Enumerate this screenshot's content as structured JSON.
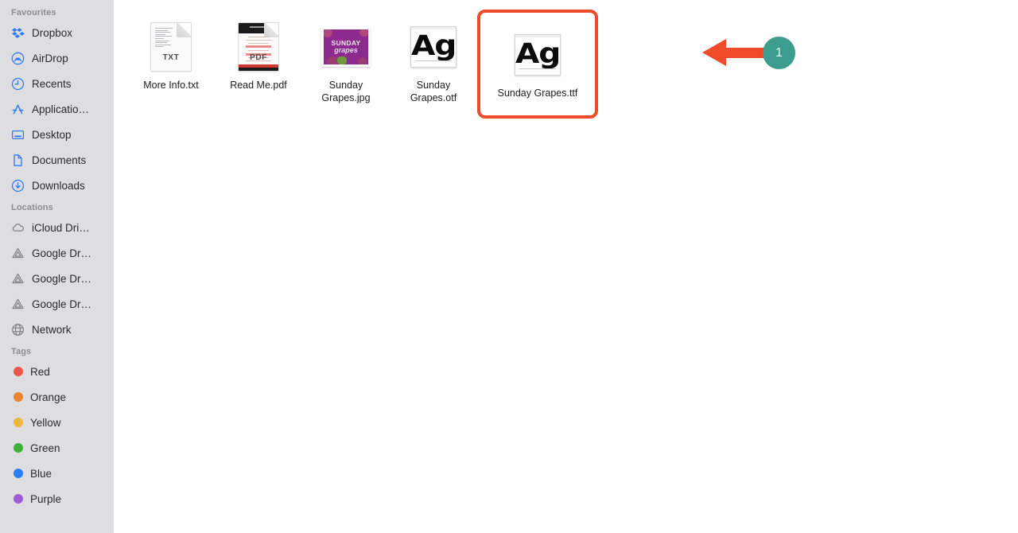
{
  "sidebar": {
    "sections": [
      {
        "title": "Favourites",
        "items": [
          {
            "label": "Dropbox",
            "icon": "dropbox-icon"
          },
          {
            "label": "AirDrop",
            "icon": "airdrop-icon"
          },
          {
            "label": "Recents",
            "icon": "clock-icon"
          },
          {
            "label": "Applicatio…",
            "icon": "applications-icon"
          },
          {
            "label": "Desktop",
            "icon": "desktop-icon"
          },
          {
            "label": "Documents",
            "icon": "document-icon"
          },
          {
            "label": "Downloads",
            "icon": "downloads-icon"
          }
        ]
      },
      {
        "title": "Locations",
        "items": [
          {
            "label": "iCloud Dri…",
            "icon": "icloud-icon"
          },
          {
            "label": "Google Dr…",
            "icon": "google-drive-icon"
          },
          {
            "label": "Google Dr…",
            "icon": "google-drive-icon"
          },
          {
            "label": "Google Dr…",
            "icon": "google-drive-icon"
          },
          {
            "label": "Network",
            "icon": "network-globe-icon"
          }
        ]
      },
      {
        "title": "Tags",
        "items": [
          {
            "label": "Red",
            "icon": "tag-dot-icon",
            "color": "#f0544a"
          },
          {
            "label": "Orange",
            "icon": "tag-dot-icon",
            "color": "#e8852f"
          },
          {
            "label": "Yellow",
            "icon": "tag-dot-icon",
            "color": "#edb93c"
          },
          {
            "label": "Green",
            "icon": "tag-dot-icon",
            "color": "#3cb23c"
          },
          {
            "label": "Blue",
            "icon": "tag-dot-icon",
            "color": "#2b7df5"
          },
          {
            "label": "Purple",
            "icon": "tag-dot-icon",
            "color": "#a05bd6"
          }
        ]
      }
    ]
  },
  "files": [
    {
      "name": "More Info.txt",
      "kind": "TXT",
      "icon": "txt-file-icon",
      "selected": false
    },
    {
      "name": "Read Me.pdf",
      "kind": "PDF",
      "icon": "pdf-file-icon",
      "selected": false
    },
    {
      "name": "Sunday Grapes.jpg",
      "kind": "JPG",
      "icon": "image-thumbnail-icon",
      "selected": false
    },
    {
      "name": "Sunday Grapes.otf",
      "kind": "OTF",
      "icon": "font-file-icon",
      "selected": false
    },
    {
      "name": "Sunday Grapes.ttf",
      "kind": "TTF",
      "icon": "font-file-icon",
      "selected": true
    }
  ],
  "thumbnail": {
    "line1": "SUNDAY",
    "line2": "grapes"
  },
  "font_icon": {
    "sample_text": "Ag"
  },
  "annotation": {
    "badge_number": "1",
    "arrow_color": "#ee4b2b",
    "badge_color": "#3c9c8d",
    "highlight_color": "#ee4b2b"
  }
}
